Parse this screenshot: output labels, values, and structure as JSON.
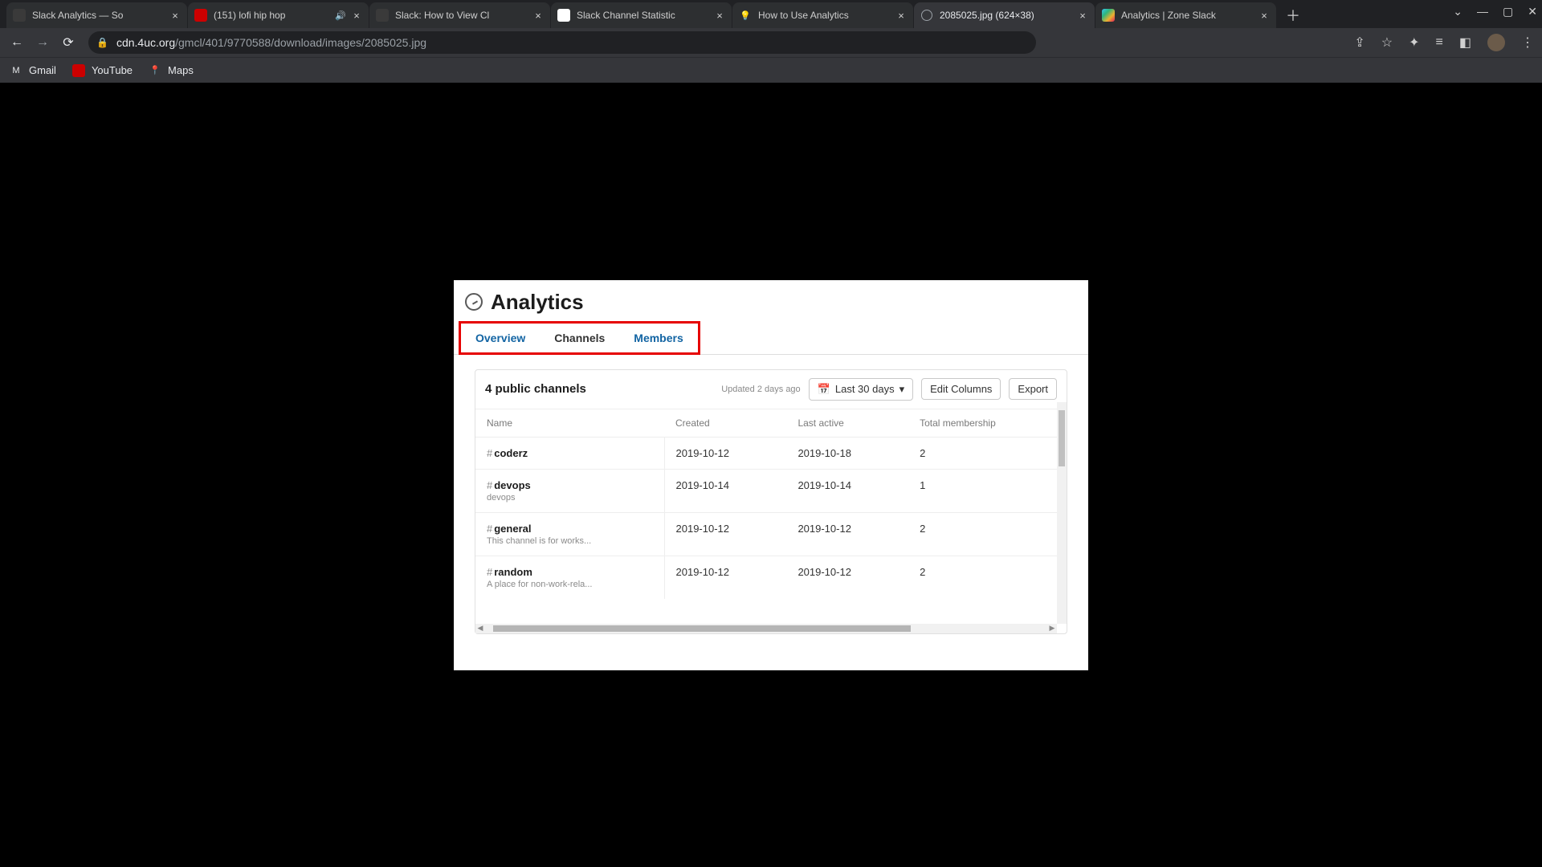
{
  "browser": {
    "tabs": [
      {
        "title": "Slack Analytics — So",
        "active": false,
        "audio": false
      },
      {
        "title": "(151) lofi hip hop",
        "active": false,
        "audio": true
      },
      {
        "title": "Slack: How to View Cl",
        "active": false,
        "audio": false
      },
      {
        "title": "Slack Channel Statistic",
        "active": false,
        "audio": false
      },
      {
        "title": "How to Use Analytics",
        "active": false,
        "audio": false
      },
      {
        "title": "2085025.jpg (624×38)",
        "active": true,
        "audio": false
      },
      {
        "title": "Analytics | Zone Slack",
        "active": false,
        "audio": false
      }
    ],
    "url_host": "cdn.4uc.org",
    "url_path": "/gmcl/401/9770588/download/images/2085025.jpg",
    "bookmarks": [
      {
        "label": "Gmail"
      },
      {
        "label": "YouTube"
      },
      {
        "label": "Maps"
      }
    ]
  },
  "analytics": {
    "title": "Analytics",
    "tabs": {
      "overview": "Overview",
      "channels": "Channels",
      "members": "Members"
    },
    "count_label": "4 public channels",
    "updated_label": "Updated 2 days ago",
    "range_label": "Last 30 days",
    "edit_columns_label": "Edit Columns",
    "export_label": "Export",
    "columns": {
      "name": "Name",
      "created": "Created",
      "last_active": "Last active",
      "total": "Total membership"
    },
    "rows": [
      {
        "name": "coderz",
        "desc": "",
        "created": "2019-10-12",
        "last_active": "2019-10-18",
        "total": "2"
      },
      {
        "name": "devops",
        "desc": "devops",
        "created": "2019-10-14",
        "last_active": "2019-10-14",
        "total": "1"
      },
      {
        "name": "general",
        "desc": "This channel is for works...",
        "created": "2019-10-12",
        "last_active": "2019-10-12",
        "total": "2"
      },
      {
        "name": "random",
        "desc": "A place for non-work-rela...",
        "created": "2019-10-12",
        "last_active": "2019-10-12",
        "total": "2"
      }
    ]
  }
}
